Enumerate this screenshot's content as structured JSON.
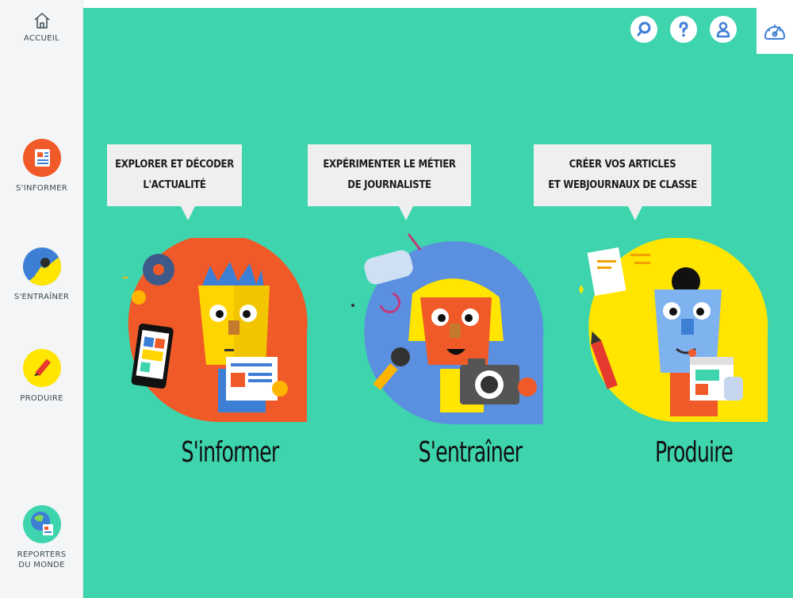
{
  "sidebar": {
    "home_label": "ACCUEIL",
    "items": [
      {
        "label": "S'INFORMER",
        "color": "#f05a28"
      },
      {
        "label": "S'ENTRAÎNER",
        "color": "#3e7fd6"
      },
      {
        "label": "PRODUIRE",
        "color": "#ffe500"
      },
      {
        "label": "REPORTERS\nDU MONDE",
        "color": "#3ed4ae"
      }
    ]
  },
  "top_icons": [
    "search-icon",
    "help-icon",
    "user-icon",
    "dashboard-icon"
  ],
  "cards": [
    {
      "bubble": "EXPLORER ET DÉCODER\nL'ACTUALITÉ",
      "title": "S'informer",
      "blob_color": "#f05a28"
    },
    {
      "bubble": "EXPÉRIMENTER LE MÉTIER\nDE JOURNALISTE",
      "title": "S'entraîner",
      "blob_color": "#5b8fe0"
    },
    {
      "bubble": "CRÉER VOS ARTICLES\nET WEBJOURNAUX DE CLASSE",
      "title": "Produire",
      "blob_color": "#ffe500"
    }
  ],
  "colors": {
    "main_bg": "#3ed4ae",
    "sidebar_bg": "#f3f5f6",
    "accent_blue": "#3e7fd6"
  }
}
